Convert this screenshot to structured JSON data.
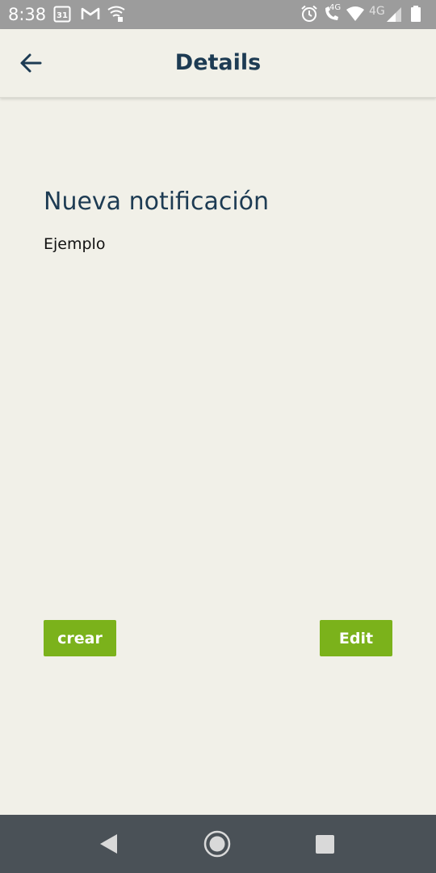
{
  "status_bar": {
    "time": "8:38",
    "calendar_day": "31",
    "network_label": "4G",
    "call_label": "4G"
  },
  "app_bar": {
    "title": "Details"
  },
  "notification": {
    "title": "Nueva notificación",
    "body": "Ejemplo"
  },
  "actions": {
    "create_label": "crear",
    "edit_label": "Edit"
  },
  "colors": {
    "accent_green": "#7bb21b",
    "title_navy": "#1d3b53",
    "background": "#f1f0e8",
    "status_bar": "#9c9c9c",
    "nav_bar": "#4a5157"
  },
  "icons": {
    "back": "arrow-left-icon",
    "calendar": "calendar-icon",
    "gmail": "gmail-icon",
    "wifi_calling": "wifi-calling-icon",
    "alarm": "alarm-icon",
    "volte_call": "volte-call-icon",
    "wifi": "wifi-icon",
    "signal": "signal-icon",
    "battery": "battery-icon",
    "nav_back": "nav-back-icon",
    "nav_home": "nav-home-icon",
    "nav_recents": "nav-recents-icon"
  }
}
